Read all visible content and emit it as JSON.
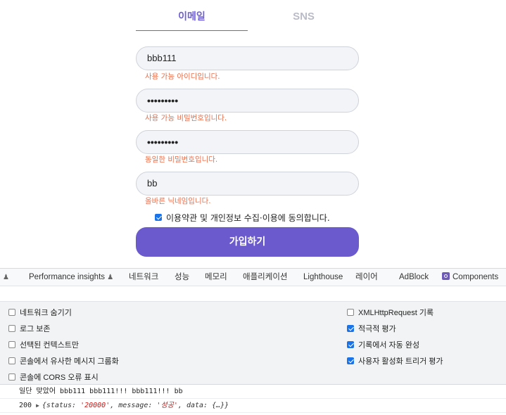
{
  "signup": {
    "tabs": {
      "email": "이메일",
      "sns": "SNS"
    },
    "id_value": "bbb111",
    "id_msg": "사용 가능 아이디입니다.",
    "pw_value": "•••••••••",
    "pw_msg": "사용 가능 비밀번호입니다.",
    "pw_confirm_value": "•••••••••",
    "pw_confirm_msg": "동일한 비밀번호입니다.",
    "nick_value": "bb",
    "nick_msg": "올바른 닉네임입니다.",
    "agree_label": "이용약관 및 개인정보 수집·이용에 동의합니다.",
    "agree_checked": true,
    "join_button": "가입하기"
  },
  "devtools": {
    "tabs": {
      "performance_insights": "Performance insights",
      "network": "네트워크",
      "performance": "성능",
      "memory": "메모리",
      "application": "애플리케이션",
      "lighthouse": "Lighthouse",
      "layers": "레이어",
      "adblock": "AdBlock",
      "components": "Components"
    },
    "settings": {
      "left": [
        {
          "label": "네트워크 숨기기",
          "checked": false
        },
        {
          "label": "로그 보존",
          "checked": false
        },
        {
          "label": "선택된 컨텍스트만",
          "checked": false
        },
        {
          "label": "콘솔에서 유사한 메시지 그룹화",
          "checked": false
        },
        {
          "label": "콘솔에 CORS 오류 표시",
          "checked": false
        }
      ],
      "right": [
        {
          "label": "XMLHttpRequest 기록",
          "checked": false
        },
        {
          "label": "적극적 평가",
          "checked": true
        },
        {
          "label": "기록에서 자동 완성",
          "checked": true
        },
        {
          "label": "사용자 활성화 트리거 평가",
          "checked": true
        }
      ]
    },
    "console": {
      "line1": "일단 맞았어 bbb111 bbb111!!! bbb111!!! bb",
      "line2_prefix": "200",
      "line2_open": "{status: ",
      "line2_status": "'20000'",
      "line2_mid": ", message: ",
      "line2_message": "'성공'",
      "line2_end": ", data: {…}}"
    }
  }
}
